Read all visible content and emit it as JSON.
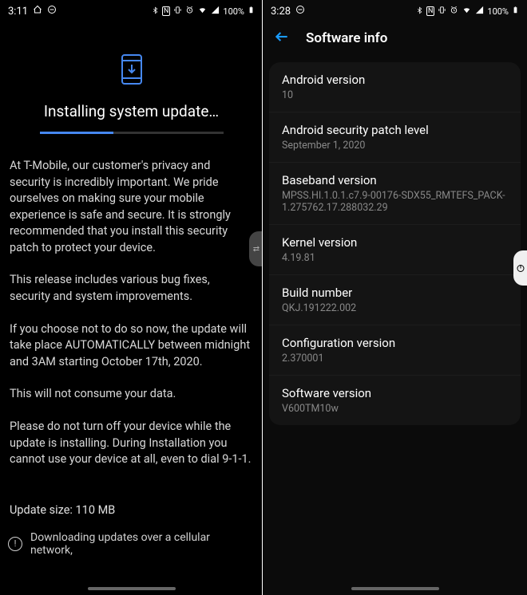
{
  "left": {
    "status": {
      "time": "3:11",
      "battery_text": "100%"
    },
    "update": {
      "title": "Installing system update…",
      "para1": "At T-Mobile, our customer's privacy and security is incredibly important. We pride ourselves on making sure your mobile experience is safe and secure. It is strongly recommended that you install this security patch to protect your device.",
      "para2": "This release includes various bug fixes, security and system improvements.",
      "para3": "If you choose not to do so now, the update will take place AUTOMATICALLY between midnight and 3AM starting October 17th, 2020.",
      "para4": "This will not consume your data.",
      "para5": "Please do not turn off your device while the update is installing. During Installation you cannot use your device at all, even to dial 9-1-1.",
      "size_label": "Update size: 110 MB",
      "cellular_warning": "Downloading updates over a cellular network,"
    }
  },
  "right": {
    "status": {
      "time": "3:28",
      "battery_text": "100%"
    },
    "header": {
      "title": "Software info"
    },
    "items": [
      {
        "label": "Android version",
        "value": "10"
      },
      {
        "label": "Android security patch level",
        "value": "September 1, 2020"
      },
      {
        "label": "Baseband version",
        "value": "MPSS.HI.1.0.1.c7.9-00176-SDX55_RMTEFS_PACK-1.275762.17.288032.29"
      },
      {
        "label": "Kernel version",
        "value": "4.19.81"
      },
      {
        "label": "Build number",
        "value": "QKJ.191222.002"
      },
      {
        "label": "Configuration version",
        "value": "2.370001"
      },
      {
        "label": "Software version",
        "value": "V600TM10w"
      }
    ]
  }
}
